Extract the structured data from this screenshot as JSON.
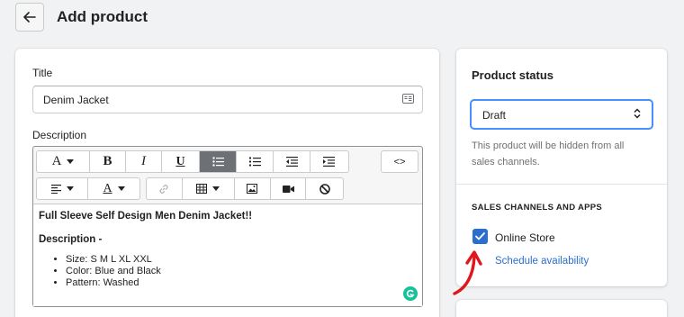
{
  "header": {
    "title": "Add product",
    "back_icon": "arrow-left-icon"
  },
  "main": {
    "title_label": "Title",
    "title_value": "Denim Jacket",
    "description_label": "Description",
    "toolbar": {
      "row1": [
        "A",
        "B",
        "I",
        "U",
        "bulleted-list",
        "numbered-list",
        "outdent",
        "indent",
        "<>"
      ],
      "row2": [
        "align",
        "text-color",
        "link",
        "table",
        "image",
        "video",
        "clear-format"
      ]
    },
    "content": {
      "heading": "Full Sleeve Self Design Men Denim Jacket!!",
      "subheading": "Description -",
      "items": [
        "Size: S M L XL XXL",
        "Color: Blue and Black",
        "Pattern: Washed"
      ]
    }
  },
  "sidebar": {
    "status_title": "Product status",
    "status_value": "Draft",
    "status_help": "This product will be hidden from all sales channels.",
    "channels_title": "SALES CHANNELS AND APPS",
    "channel_name": "Online Store",
    "channel_checked": true,
    "schedule_link": "Schedule availability"
  },
  "colors": {
    "accent": "#2c6ecb",
    "focus": "#458fff",
    "annotation": "#e0161d",
    "grammarly": "#15c39a"
  }
}
